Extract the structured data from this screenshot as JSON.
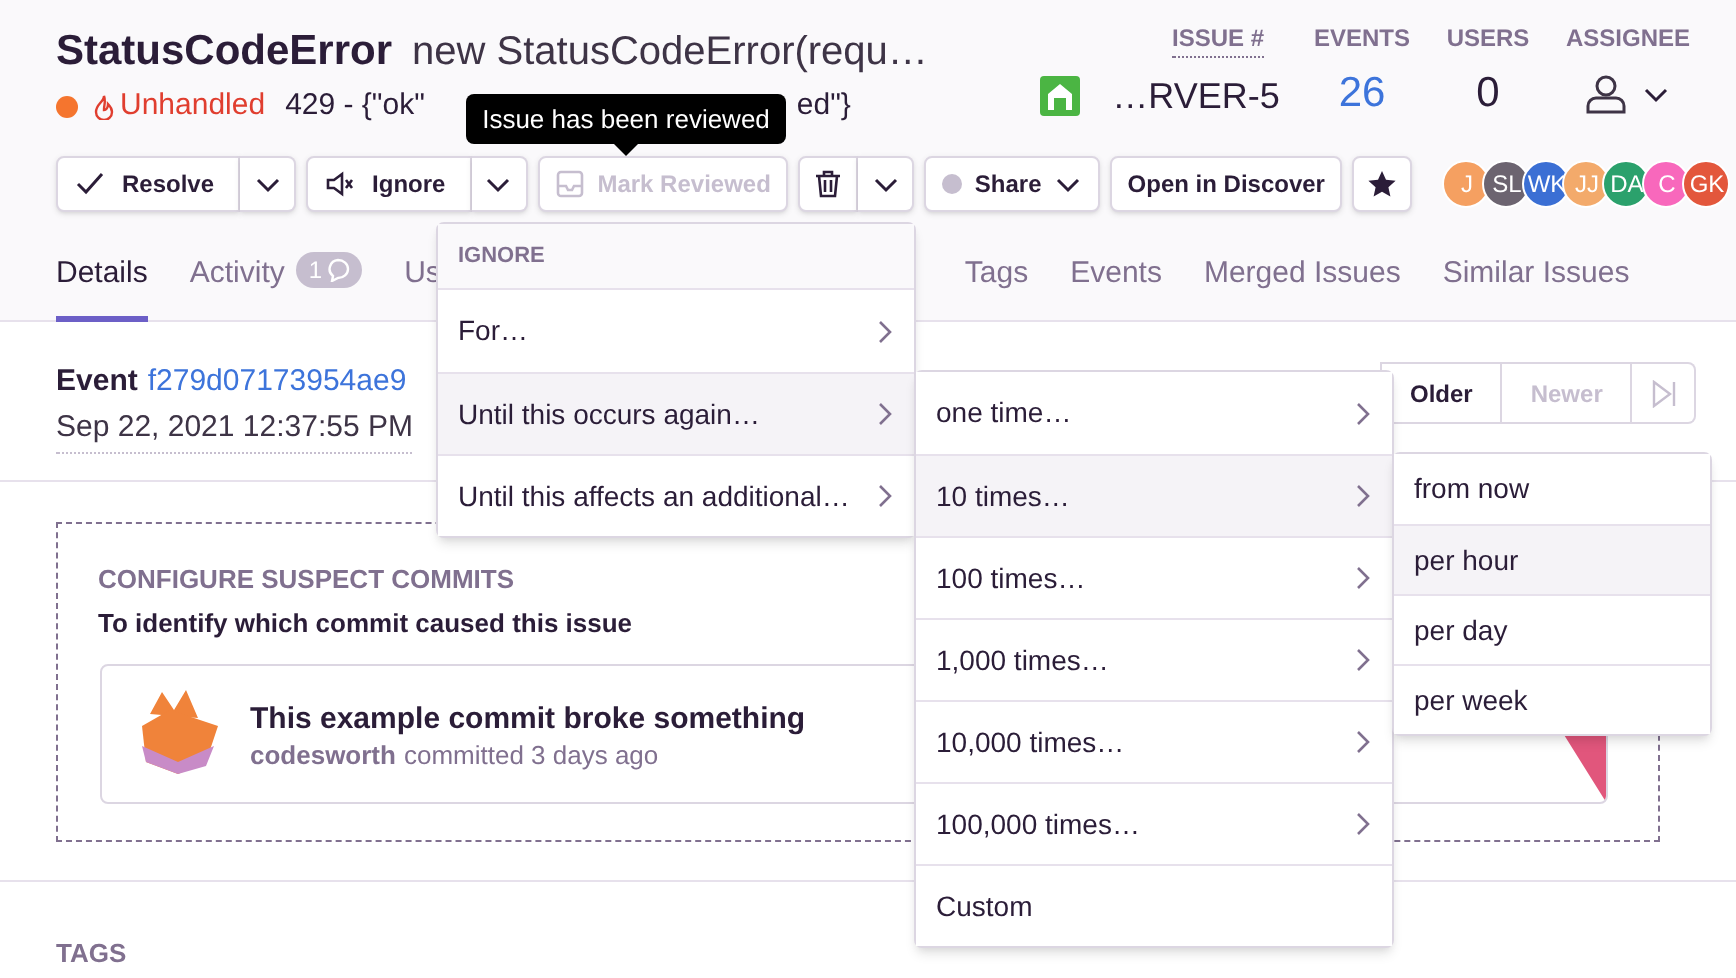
{
  "header": {
    "title": "StatusCodeError",
    "subtitle": "new StatusCodeError(requ…",
    "unhandled": "Unhandled",
    "message_parts": [
      "429 - {\"ok\"",
      "ed\"}"
    ]
  },
  "stats": [
    {
      "label": "ISSUE #",
      "value": "…RVER-5",
      "kind": "issue"
    },
    {
      "label": "EVENTS",
      "value": "26",
      "kind": "link"
    },
    {
      "label": "USERS",
      "value": "0",
      "kind": "plain"
    },
    {
      "label": "ASSIGNEE",
      "kind": "assignee"
    }
  ],
  "actions": [
    {
      "kind": "resolve",
      "label": "Resolve"
    },
    {
      "kind": "ignore",
      "label": "Ignore"
    },
    {
      "kind": "review",
      "label": "Mark Reviewed",
      "disabled": true
    },
    {
      "kind": "delete"
    },
    {
      "kind": "share",
      "label": "Share"
    },
    {
      "kind": "discover",
      "label": "Open in Discover"
    },
    {
      "kind": "bookmark"
    }
  ],
  "tooltip": "Issue has been reviewed",
  "participants": [
    {
      "initials": "J",
      "color": "#f5a061"
    },
    {
      "initials": "SL",
      "color": "#6c6470"
    },
    {
      "initials": "WK",
      "color": "#3b6fd4"
    },
    {
      "initials": "JJ",
      "color": "#f3aa6b"
    },
    {
      "initials": "DA",
      "color": "#2ba16c"
    },
    {
      "initials": "C",
      "color": "#f868bc"
    },
    {
      "initials": "GK",
      "color": "#e3573c"
    }
  ],
  "tabs": [
    {
      "label": "Details",
      "selected": true
    },
    {
      "label": "Activity",
      "badge": "1",
      "selected": false
    },
    {
      "label": "Us",
      "selected": false
    },
    {
      "label": "Tags",
      "selected": false
    },
    {
      "label": "Events",
      "selected": false
    },
    {
      "label": "Merged Issues",
      "selected": false
    },
    {
      "label": "Similar Issues",
      "selected": false
    }
  ],
  "event": {
    "label": "Event",
    "id": "f279d07173954ae9",
    "date": "Sep 22, 2021 12:37:55 PM"
  },
  "event_nav": [
    {
      "kind": "text",
      "label": "Older",
      "disabled": false
    },
    {
      "kind": "text",
      "label": "Newer",
      "disabled": true
    },
    {
      "kind": "last"
    }
  ],
  "suspect_commits": {
    "title": "CONFIGURE SUSPECT COMMITS",
    "subtitle": "To identify which commit caused this issue",
    "commit_message": "This example commit broke something",
    "author": "codesworth",
    "meta": "committed 3 days ago"
  },
  "tags_heading": "TAGS",
  "ignore_menu": {
    "header": "IGNORE",
    "items": [
      {
        "label": "For…",
        "selected": false
      },
      {
        "label": "Until this occurs again…",
        "selected": true
      },
      {
        "label": "Until this affects an additional…",
        "selected": false
      }
    ]
  },
  "count_menu": {
    "items": [
      {
        "label": "one time…",
        "kind": "submenu",
        "selected": false
      },
      {
        "label": "10 times…",
        "kind": "submenu",
        "selected": true
      },
      {
        "label": "100 times…",
        "kind": "submenu",
        "selected": false
      },
      {
        "label": "1,000 times…",
        "kind": "submenu",
        "selected": false
      },
      {
        "label": "10,000 times…",
        "kind": "submenu",
        "selected": false
      },
      {
        "label": "100,000 times…",
        "kind": "submenu",
        "selected": false
      },
      {
        "label": "Custom",
        "kind": "action",
        "selected": false
      }
    ]
  },
  "window_menu": {
    "items": [
      {
        "label": "from now",
        "selected": false
      },
      {
        "label": "per hour",
        "selected": true
      },
      {
        "label": "per day",
        "selected": false
      },
      {
        "label": "per week",
        "selected": false
      }
    ]
  }
}
